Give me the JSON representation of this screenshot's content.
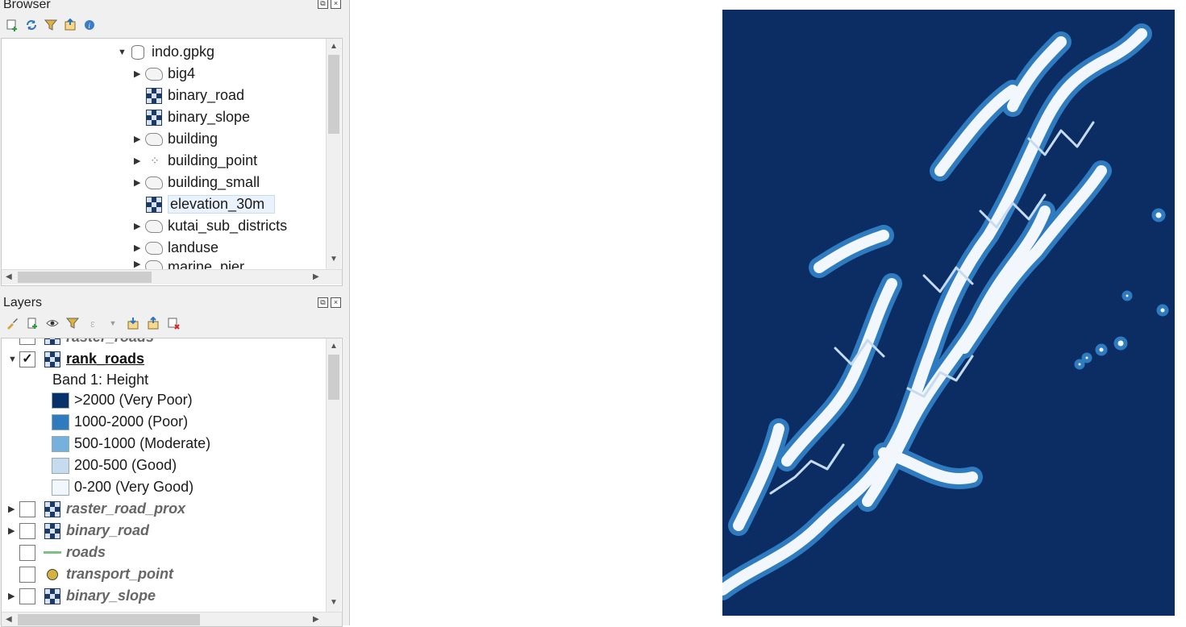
{
  "browser": {
    "title": "Browser",
    "items": [
      {
        "label": "indo.gpkg",
        "icon": "database-icon",
        "expander": "expanded"
      },
      {
        "label": "big4",
        "icon": "polygon-layer-icon",
        "expander": "collapsed"
      },
      {
        "label": "binary_road",
        "icon": "raster-layer-icon",
        "expander": "none"
      },
      {
        "label": "binary_slope",
        "icon": "raster-layer-icon",
        "expander": "none"
      },
      {
        "label": "building",
        "icon": "polygon-layer-icon",
        "expander": "collapsed"
      },
      {
        "label": "building_point",
        "icon": "point-layer-icon",
        "expander": "collapsed"
      },
      {
        "label": "building_small",
        "icon": "polygon-layer-icon",
        "expander": "collapsed"
      },
      {
        "label": "elevation_30m",
        "icon": "raster-layer-icon",
        "expander": "none",
        "selected": true
      },
      {
        "label": "kutai_sub_districts",
        "icon": "polygon-layer-icon",
        "expander": "collapsed"
      },
      {
        "label": "landuse",
        "icon": "polygon-layer-icon",
        "expander": "collapsed"
      },
      {
        "label": "marine_pier",
        "icon": "polygon-layer-icon",
        "expander": "collapsed"
      }
    ]
  },
  "layers": {
    "title": "Layers",
    "partial_top": "raster_roads",
    "active": {
      "label": "rank_roads",
      "checked": true
    },
    "band_label": "Band 1: Height",
    "legend": [
      {
        "label": ">2000 (Very Poor)",
        "color": "#08306b"
      },
      {
        "label": "1000-2000 (Poor)",
        "color": "#2f7bbf"
      },
      {
        "label": "500-1000 (Moderate)",
        "color": "#76b0dc"
      },
      {
        "label": "200-500 (Good)",
        "color": "#c6dbef"
      },
      {
        "label": "0-200 (Very Good)",
        "color": "#f2f7fd"
      }
    ],
    "others": [
      {
        "label": "raster_road_prox",
        "icon": "raster-layer-icon",
        "expander": true
      },
      {
        "label": "binary_road",
        "icon": "raster-layer-icon",
        "expander": true
      },
      {
        "label": "roads",
        "icon": "line-layer-icon",
        "expander": false
      },
      {
        "label": "transport_point",
        "icon": "point-symbol-icon",
        "expander": false
      },
      {
        "label": "binary_slope",
        "icon": "raster-layer-icon",
        "expander": true
      }
    ]
  },
  "map": {
    "background": "#0c2d64",
    "road_color": "#f2f7fd",
    "buffer_color": "#2f7bbf"
  }
}
